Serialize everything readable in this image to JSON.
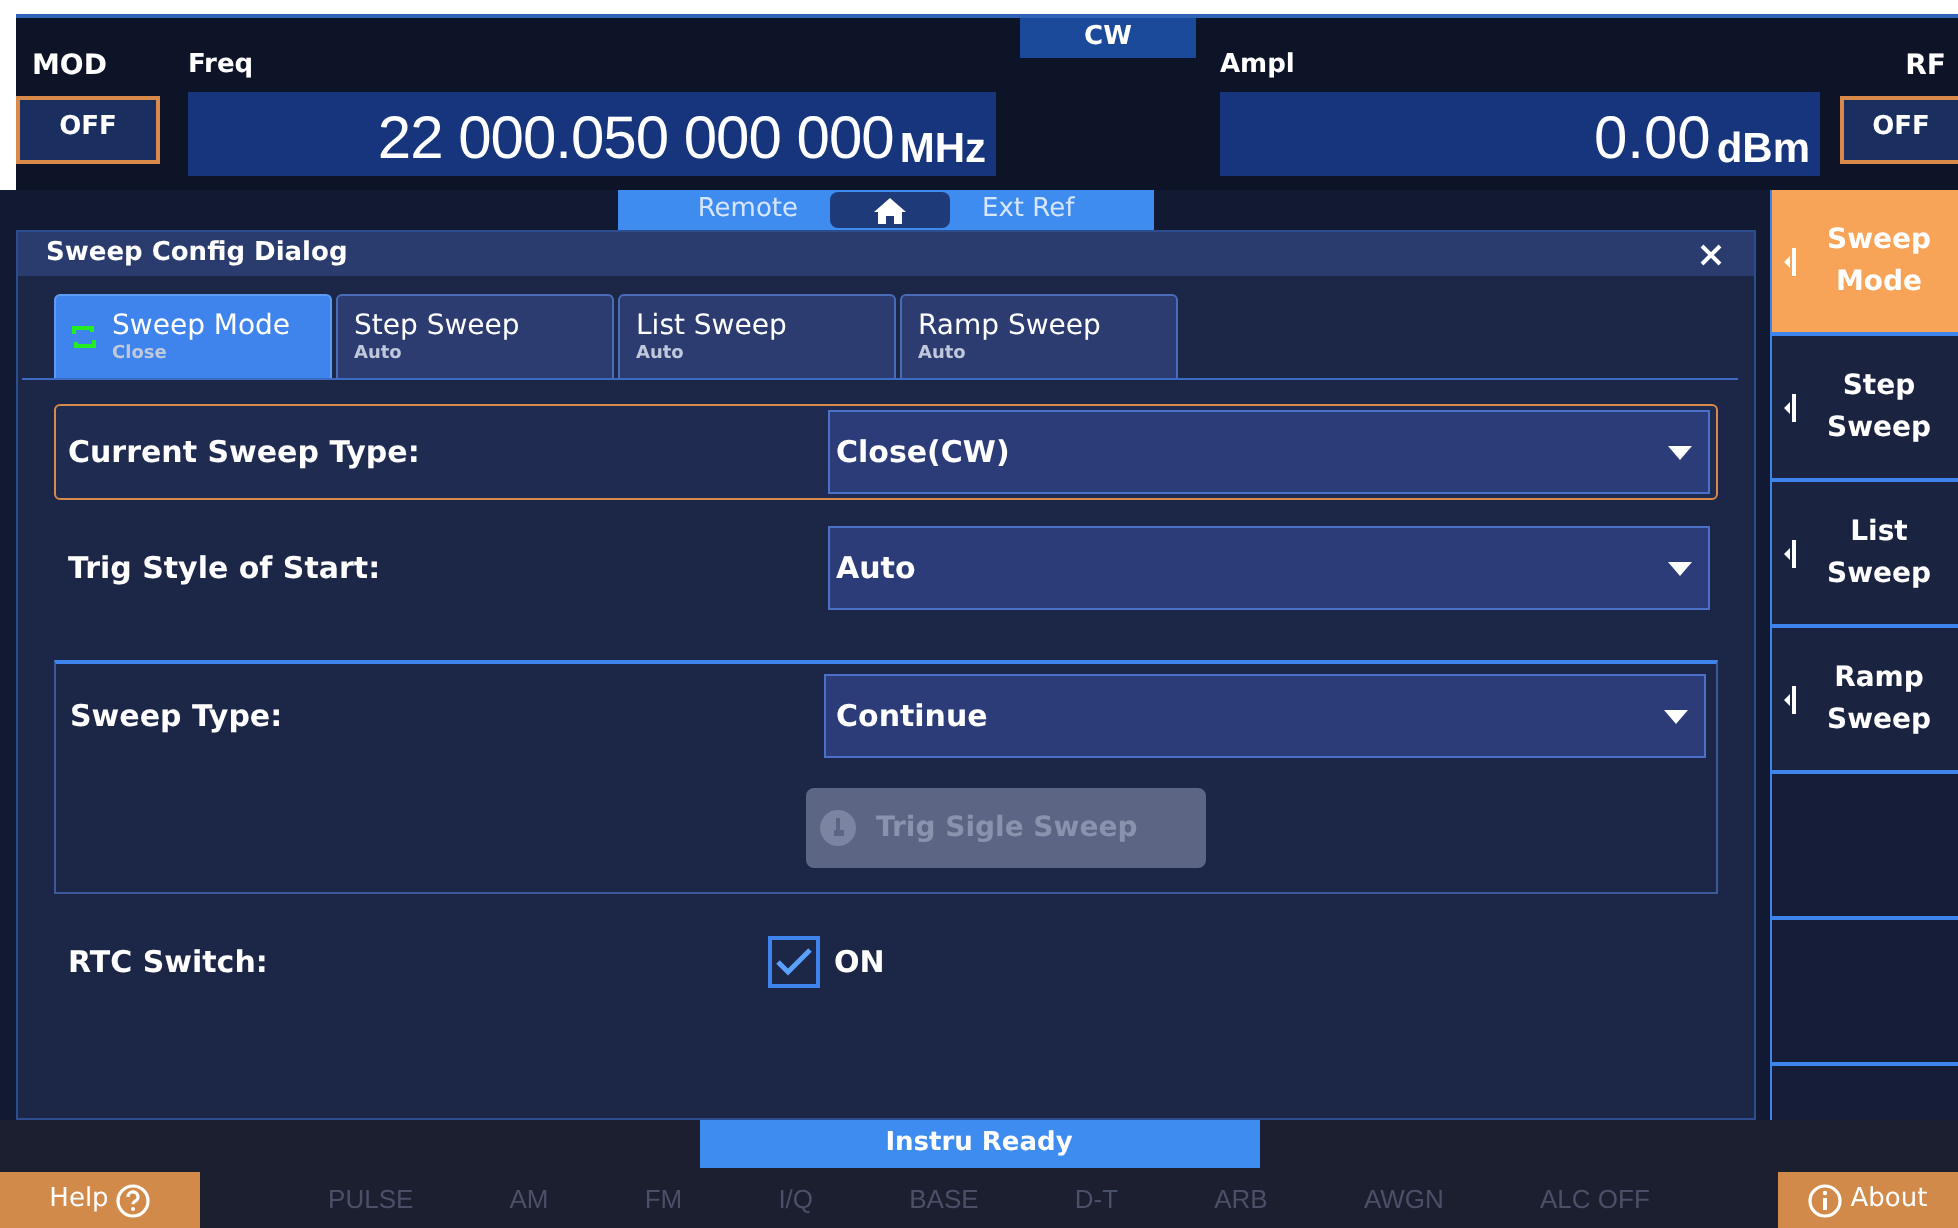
{
  "mod": {
    "label": "MOD",
    "state": "OFF"
  },
  "freq": {
    "label": "Freq",
    "value": "22 000.050 000 000",
    "unit": "MHz"
  },
  "mode": "CW",
  "ampl": {
    "label": "Ampl",
    "value": "0.00",
    "unit": "dBm"
  },
  "rf": {
    "label": "RF",
    "state": "OFF"
  },
  "indicators": [
    {
      "label": "Remote",
      "active": false
    },
    {
      "label": "Ext Ref",
      "active": false
    }
  ],
  "dialog": {
    "title": "Sweep Config Dialog",
    "tabs": [
      {
        "label": "Sweep Mode",
        "sublabel": "Close",
        "selected": true
      },
      {
        "label": "Step Sweep",
        "sublabel": "Auto",
        "selected": false
      },
      {
        "label": "List Sweep",
        "sublabel": "Auto",
        "selected": false
      },
      {
        "label": "Ramp Sweep",
        "sublabel": "Auto",
        "selected": false
      }
    ],
    "settings": [
      {
        "kind": "dropdown",
        "label": "Current Sweep Type:",
        "value": "Close(CW)",
        "focused": true
      },
      {
        "kind": "dropdown",
        "label": "Trig Style of Start:",
        "value": "Auto",
        "focused": false
      },
      {
        "kind": "group",
        "label": "Sweep Type:",
        "value": "Continue",
        "button": {
          "label": "Trig Sigle Sweep",
          "disabled": true
        }
      },
      {
        "kind": "checkbox",
        "label": "RTC Switch:",
        "text": "ON",
        "checked": true
      }
    ]
  },
  "softkeys": [
    {
      "label": "Sweep Mode",
      "selected": true
    },
    {
      "label": "Step Sweep",
      "selected": false
    },
    {
      "label": "List Sweep",
      "selected": false
    },
    {
      "label": "Ramp Sweep",
      "selected": false
    }
  ],
  "status": "Instru Ready",
  "help": "Help",
  "about": "About",
  "modules": [
    {
      "label": "PULSE",
      "active": false
    },
    {
      "label": "AM",
      "active": false
    },
    {
      "label": "FM",
      "active": false
    },
    {
      "label": "I/Q",
      "active": false
    },
    {
      "label": "BASE",
      "active": false
    },
    {
      "label": "D-T",
      "active": false
    },
    {
      "label": "ARB",
      "active": false
    },
    {
      "label": "AWGN",
      "active": false
    },
    {
      "label": "ALC OFF",
      "active": false
    }
  ]
}
